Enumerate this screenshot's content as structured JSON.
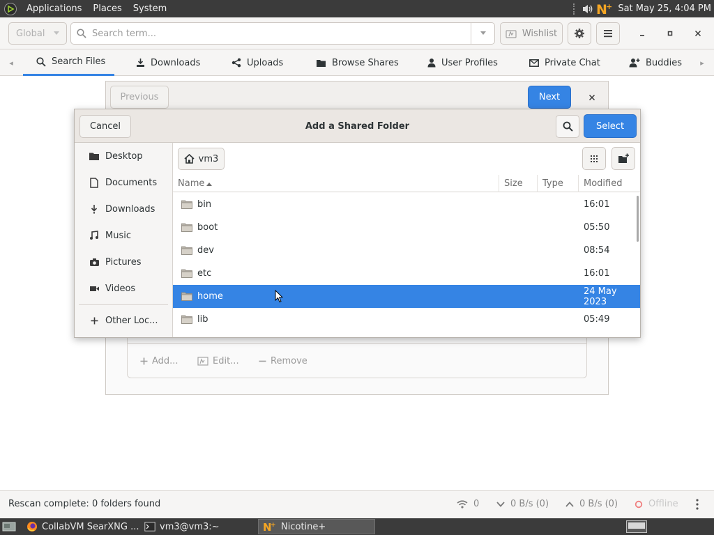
{
  "top_panel": {
    "menus": [
      "Applications",
      "Places",
      "System"
    ],
    "clock": "Sat May 25,  4:04 PM"
  },
  "header": {
    "scope_combo": "Global",
    "search_placeholder": "Search term...",
    "wishlist_label": "Wishlist"
  },
  "tabs": [
    {
      "label": "Search Files",
      "icon": "search-icon",
      "active": true
    },
    {
      "label": "Downloads",
      "icon": "download-icon"
    },
    {
      "label": "Uploads",
      "icon": "share-icon"
    },
    {
      "label": "Browse Shares",
      "icon": "folder-icon"
    },
    {
      "label": "User Profiles",
      "icon": "person-icon"
    },
    {
      "label": "Private Chat",
      "icon": "mail-icon"
    },
    {
      "label": "Buddies",
      "icon": "add-user-icon"
    }
  ],
  "wizard": {
    "previous_label": "Previous",
    "next_label": "Next",
    "add_label": "Add...",
    "edit_label": "Edit...",
    "remove_label": "Remove"
  },
  "chooser": {
    "title": "Add a Shared Folder",
    "cancel_label": "Cancel",
    "select_label": "Select",
    "path_home": "vm3",
    "places": [
      "Desktop",
      "Documents",
      "Downloads",
      "Music",
      "Pictures",
      "Videos"
    ],
    "other_locations": "Other Loc...",
    "columns": {
      "name": "Name",
      "size": "Size",
      "type": "Type",
      "modified": "Modified"
    },
    "files": [
      {
        "name": "bin",
        "modified": "16:01"
      },
      {
        "name": "boot",
        "modified": "05:50"
      },
      {
        "name": "dev",
        "modified": "08:54"
      },
      {
        "name": "etc",
        "modified": "16:01"
      },
      {
        "name": "home",
        "modified": "24 May 2023",
        "selected": true
      },
      {
        "name": "lib",
        "modified": "05:49"
      }
    ]
  },
  "status_bar": {
    "message": "Rescan complete: 0 folders found",
    "connections": "0",
    "download_speed": "0 B/s (0)",
    "upload_speed": "0 B/s (0)",
    "connection_status": "Offline"
  },
  "taskbar": {
    "tasks": [
      {
        "label": "CollabVM SearXNG ...",
        "icon": "firefox-icon"
      },
      {
        "label": "vm3@vm3:~",
        "icon": "terminal-icon"
      },
      {
        "label": "Nicotine+",
        "icon": "nicotine-icon",
        "active": true
      }
    ]
  },
  "colors": {
    "accent": "#3584e4",
    "panel": "#3b3b3b",
    "nicotine_brand": "#f5a623"
  }
}
